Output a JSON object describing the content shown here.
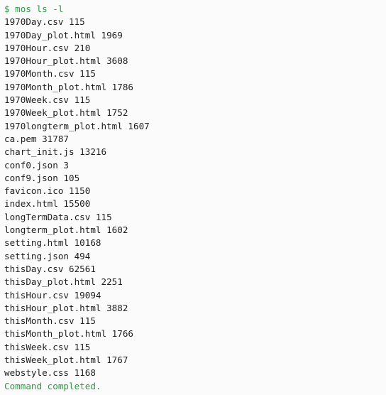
{
  "terminal": {
    "command": "$ mos ls -l",
    "files": [
      {
        "name": "1970Day.csv",
        "size": "115"
      },
      {
        "name": "1970Day_plot.html",
        "size": "1969"
      },
      {
        "name": "1970Hour.csv",
        "size": "210"
      },
      {
        "name": "1970Hour_plot.html",
        "size": "3608"
      },
      {
        "name": "1970Month.csv",
        "size": "115"
      },
      {
        "name": "1970Month_plot.html",
        "size": "1786"
      },
      {
        "name": "1970Week.csv",
        "size": "115"
      },
      {
        "name": "1970Week_plot.html",
        "size": "1752"
      },
      {
        "name": "1970longterm_plot.html",
        "size": "1607"
      },
      {
        "name": "ca.pem",
        "size": "31787"
      },
      {
        "name": "chart_init.js",
        "size": "13216"
      },
      {
        "name": "conf0.json",
        "size": "3"
      },
      {
        "name": "conf9.json",
        "size": "105"
      },
      {
        "name": "favicon.ico",
        "size": "1150"
      },
      {
        "name": "index.html",
        "size": "15500"
      },
      {
        "name": "longTermData.csv",
        "size": "115"
      },
      {
        "name": "longterm_plot.html",
        "size": "1602"
      },
      {
        "name": "setting.html",
        "size": "10168"
      },
      {
        "name": "setting.json",
        "size": "494"
      },
      {
        "name": "thisDay.csv",
        "size": "62561"
      },
      {
        "name": "thisDay_plot.html",
        "size": "2251"
      },
      {
        "name": "thisHour.csv",
        "size": "19094"
      },
      {
        "name": "thisHour_plot.html",
        "size": "3882"
      },
      {
        "name": "thisMonth.csv",
        "size": "115"
      },
      {
        "name": "thisMonth_plot.html",
        "size": "1766"
      },
      {
        "name": "thisWeek.csv",
        "size": "115"
      },
      {
        "name": "thisWeek_plot.html",
        "size": "1767"
      },
      {
        "name": "webstyle.css",
        "size": "1168"
      }
    ],
    "status": "Command completed.",
    "colors": {
      "prompt": "#2c9a43",
      "text": "#1f1f1f",
      "background": "#fbfbfb"
    }
  }
}
